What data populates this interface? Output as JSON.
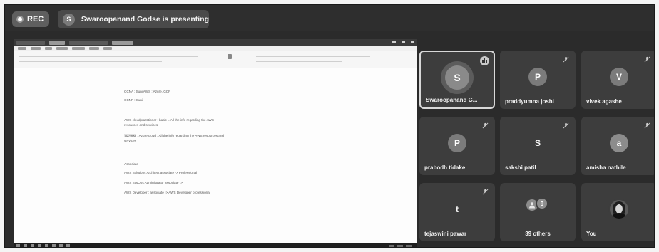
{
  "topbar": {
    "rec_label": "REC",
    "presenter_initial": "S",
    "presenter_text": "Swaroopanand Godse is presenting"
  },
  "shared_document": {
    "lines": [
      "CCNA : Suni     AWS : Azure, GCP",
      "CCNP : Suni",
      "AWS cloudpractitioner : basic = All the info regarding the AWS",
      "resources and services",
      "AZ-900 : Azure cloud : All the info regarding the AWS resources and",
      "services",
      "Associate",
      "AWS Solutions Architect associate -> Professional",
      "AWS SysOps Administrator associate ->",
      "AWS Developer : associate -> AWS Developer professional"
    ],
    "highlight": "AZ-900"
  },
  "participants": [
    {
      "initial": "S",
      "name": "Swaroopanand G...",
      "muted": false,
      "speaking": true
    },
    {
      "initial": "P",
      "name": "praddyumna joshi",
      "muted": true
    },
    {
      "initial": "V",
      "name": "vivek agashe",
      "muted": true
    },
    {
      "initial": "P",
      "name": "prabodh tidake",
      "muted": true
    },
    {
      "initial": "S",
      "name": "sakshi patil",
      "muted": true
    },
    {
      "initial": "a",
      "name": "amisha nathile",
      "muted": true
    },
    {
      "initial": "t",
      "name": "tejaswini pawar",
      "muted": true
    },
    {
      "initial": "9",
      "name": "39 others",
      "muted": false
    },
    {
      "initial": "",
      "name": "You",
      "muted": false
    }
  ]
}
